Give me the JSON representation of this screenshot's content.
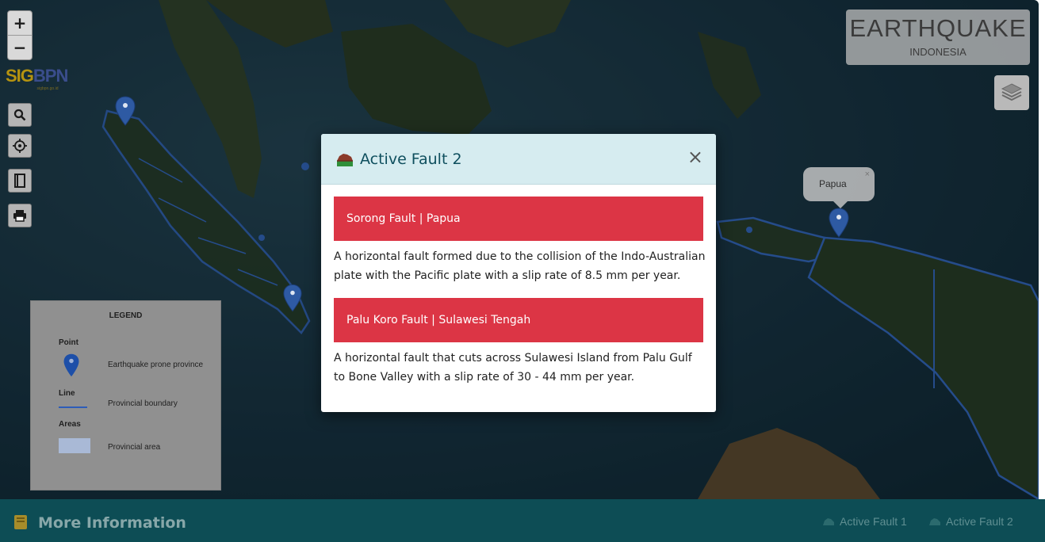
{
  "map": {
    "zoom_in": "+",
    "zoom_out": "−",
    "logo_part1": "SIG",
    "logo_part2": "BPN",
    "logo_sub": "sigbpn.go.id",
    "tools": [
      {
        "icon": "search-icon"
      },
      {
        "icon": "crosshair-icon"
      },
      {
        "icon": "bookmark-icon"
      },
      {
        "icon": "print-icon"
      }
    ],
    "brand_title": "EARTHQUAKE",
    "brand_subtitle": "INDONESIA",
    "layers_icon": "layers-icon",
    "popup_label": "Papua",
    "popup_close": "×"
  },
  "legend": {
    "title": "LEGEND",
    "point_label": "Point",
    "point_desc": "Earthquake prone province",
    "line_label": "Line",
    "line_desc": "Provincial boundary",
    "areas_label": "Areas",
    "areas_desc": "Provincial area",
    "pin_color": "#1d4fa8",
    "line_color": "#2d5cb8",
    "area_color": "#a9b9d6"
  },
  "modal": {
    "title": "Active Fault 2",
    "close": "×",
    "faults": [
      {
        "name": "Sorong Fault | Papua",
        "description": "A horizontal fault formed due to the collision of the Indo-Australian plate with the Pacific plate with a slip rate of 8.5 mm per year."
      },
      {
        "name": "Palu Koro Fault | Sulawesi Tengah",
        "description": "A horizontal fault that cuts across Sulawesi Island from Palu Gulf to Bone Valley with a slip rate of 30 - 44 mm per year."
      }
    ],
    "accent_color": "#dc3545"
  },
  "bottom_bar": {
    "more_info": "More Information",
    "links": [
      "Active Fault 1",
      "Active Fault 2"
    ]
  }
}
